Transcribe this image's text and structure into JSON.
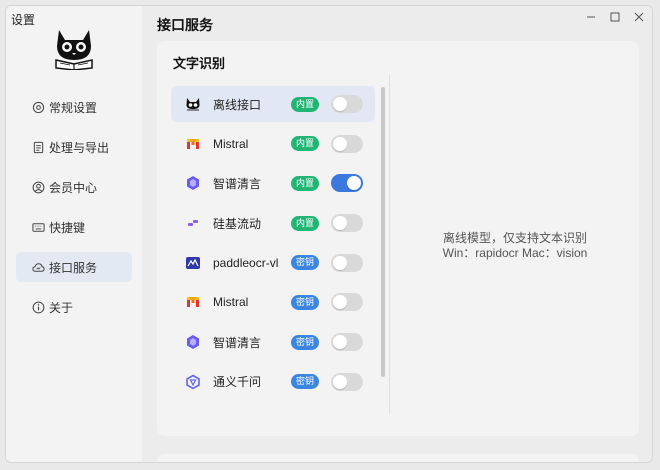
{
  "window": {
    "title": "设置"
  },
  "sidebar": {
    "items": [
      {
        "label": "常规设置",
        "icon": "gear-icon"
      },
      {
        "label": "处理与导出",
        "icon": "document-icon"
      },
      {
        "label": "会员中心",
        "icon": "user-icon"
      },
      {
        "label": "快捷键",
        "icon": "keyboard-icon"
      },
      {
        "label": "接口服务",
        "icon": "cloud-icon",
        "active": true
      },
      {
        "label": "关于",
        "icon": "info-icon"
      }
    ]
  },
  "main": {
    "title": "接口服务",
    "section_title": "文字识别",
    "providers": [
      {
        "name": "离线接口",
        "badge": "内置",
        "badge_type": "builtin",
        "enabled": false,
        "selected": true,
        "icon": "cat-logo-icon"
      },
      {
        "name": "Mistral",
        "badge": "内置",
        "badge_type": "builtin",
        "enabled": false,
        "icon": "mistral-icon"
      },
      {
        "name": "智谱清言",
        "badge": "内置",
        "badge_type": "builtin",
        "enabled": true,
        "icon": "zhipu-icon"
      },
      {
        "name": "硅基流动",
        "badge": "内置",
        "badge_type": "builtin",
        "enabled": false,
        "icon": "siliconflow-icon"
      },
      {
        "name": "paddleocr-vl",
        "badge": "密钥",
        "badge_type": "key",
        "enabled": false,
        "icon": "paddleocr-icon"
      },
      {
        "name": "Mistral",
        "badge": "密钥",
        "badge_type": "key",
        "enabled": false,
        "icon": "mistral-icon"
      },
      {
        "name": "智谱清言",
        "badge": "密钥",
        "badge_type": "key",
        "enabled": false,
        "icon": "zhipu-icon"
      },
      {
        "name": "通义千问",
        "badge": "密钥",
        "badge_type": "key",
        "enabled": false,
        "icon": "qwen-icon"
      }
    ],
    "detail": {
      "line1": "离线模型，仅支持文本识别",
      "line2": "Win：rapidocr  Mac：vision"
    }
  },
  "colors": {
    "accent": "#3b79e0",
    "builtin_badge": "#21b574",
    "key_badge": "#3b86e0",
    "selected_row": "#e1e8f4"
  }
}
